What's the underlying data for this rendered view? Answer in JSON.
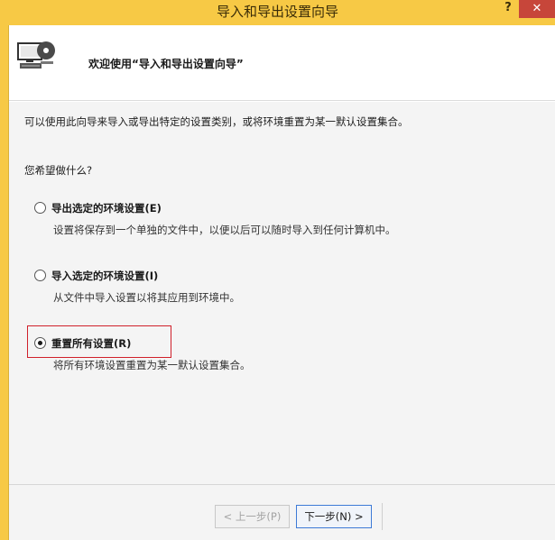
{
  "window": {
    "title": "导入和导出设置向导",
    "help_label": "?",
    "close_label": "✕"
  },
  "header": {
    "title": "欢迎使用“导入和导出设置向导”"
  },
  "content": {
    "description": "可以使用此向导来导入或导出特定的设置类别，或将环境重置为某一默认设置集合。",
    "question": "您希望做什么?",
    "options": [
      {
        "label": "导出选定的环境设置(E)",
        "description": "设置将保存到一个单独的文件中，以便以后可以随时导入到任何计算机中。",
        "selected": false
      },
      {
        "label": "导入选定的环境设置(I)",
        "description": "从文件中导入设置以将其应用到环境中。",
        "selected": false
      },
      {
        "label": "重置所有设置(R)",
        "description": "将所有环境设置重置为某一默认设置集合。",
        "selected": true
      }
    ]
  },
  "footer": {
    "prev_label": "< 上一步(P)",
    "next_label": "下一步(N) >"
  },
  "colors": {
    "titlebar": "#f7c945",
    "close_button": "#c7463a",
    "highlight": "#d0202a",
    "focus_border": "#3d7ad6"
  }
}
